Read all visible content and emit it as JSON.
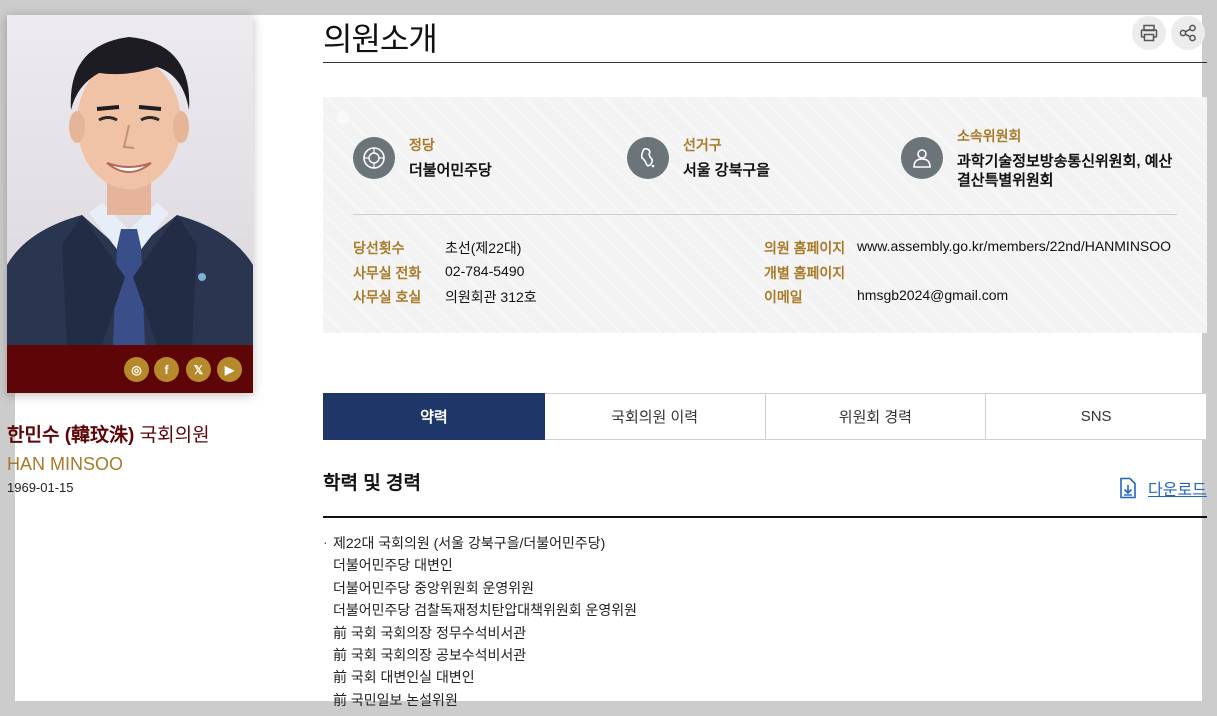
{
  "header": {
    "title": "의원소개",
    "print_icon": "print-icon",
    "share_icon": "share-icon"
  },
  "profile": {
    "name_kr": "한민수 (韓玟洙)",
    "name_suffix": "국회의원",
    "name_en": "HAN MINSOO",
    "birth": "1969-01-15",
    "sns": [
      {
        "icon": "instagram-icon",
        "glyph": "◎"
      },
      {
        "icon": "facebook-icon",
        "glyph": "f"
      },
      {
        "icon": "x-icon",
        "glyph": "𝕏"
      },
      {
        "icon": "youtube-icon",
        "glyph": "▶"
      }
    ]
  },
  "info": {
    "party_label": "정당",
    "party_value": "더불어민주당",
    "district_label": "선거구",
    "district_value": "서울 강북구을",
    "committee_label": "소속위원회",
    "committee_value": "과학기술정보방송통신위원회, 예산결산특별위원회",
    "terms_label": "당선횟수",
    "terms_value": "초선(제22대)",
    "phone_label": "사무실 전화",
    "phone_value": "02-784-5490",
    "room_label": "사무실 호실",
    "room_value": "의원회관 312호",
    "homepage_label": "의원 홈페이지",
    "homepage_value": "www.assembly.go.kr/members/22nd/HANMINSOO",
    "personal_homepage_label": "개별 홈페이지",
    "personal_homepage_value": "",
    "email_label": "이메일",
    "email_value": "hmsgb2024@gmail.com"
  },
  "tabs": [
    {
      "label": "약력",
      "active": true
    },
    {
      "label": "국회의원 이력",
      "active": false
    },
    {
      "label": "위원회 경력",
      "active": false
    },
    {
      "label": "SNS",
      "active": false
    }
  ],
  "section": {
    "title": "학력 및 경력",
    "download_label": "다운로드"
  },
  "career": [
    "제22대 국회의원 (서울 강북구을/더불어민주당)",
    "더불어민주당 대변인",
    "더불어민주당 중앙위원회 운영위원",
    "더불어민주당 검찰독재정치탄압대책위원회 운영위원",
    "前 국회 국회의장 정무수석비서관",
    "前 국회 국회의장 공보수석비서관",
    "前 국회 대변인실 대변인",
    "前 국민일보 논설위원"
  ]
}
